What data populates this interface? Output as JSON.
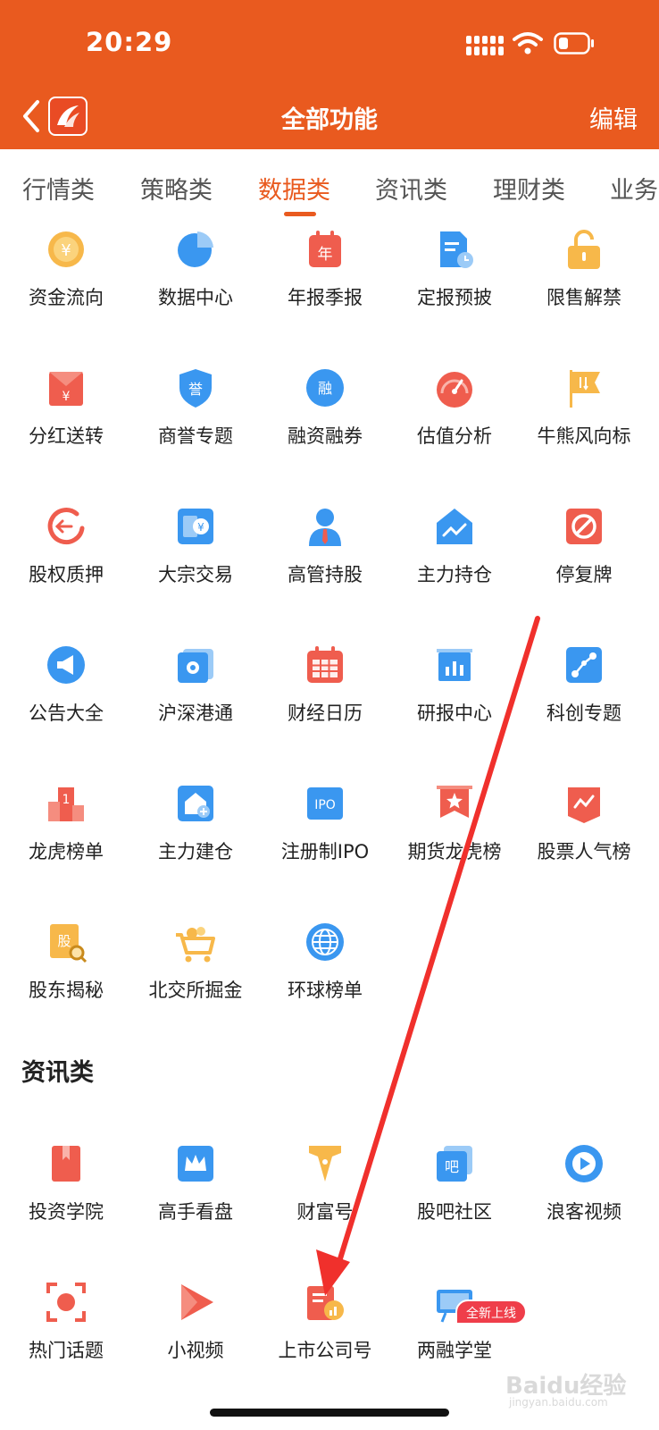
{
  "status": {
    "time": "20:29"
  },
  "header": {
    "title": "全部功能",
    "edit": "编辑"
  },
  "tabs": [
    {
      "label": "行情类"
    },
    {
      "label": "策略类"
    },
    {
      "label": "数据类",
      "active": true
    },
    {
      "label": "资讯类"
    },
    {
      "label": "理财类"
    },
    {
      "label": "业务"
    }
  ],
  "data_items": [
    {
      "label": "资金流向",
      "icon": "coin-flow-icon"
    },
    {
      "label": "数据中心",
      "icon": "pie-chart-icon"
    },
    {
      "label": "年报季报",
      "icon": "calendar-year-icon",
      "icon_text": "年"
    },
    {
      "label": "定报预披",
      "icon": "document-clock-icon"
    },
    {
      "label": "限售解禁",
      "icon": "unlock-icon"
    },
    {
      "label": "分红送转",
      "icon": "red-envelope-icon"
    },
    {
      "label": "商誉专题",
      "icon": "shield-icon",
      "icon_text": "誉"
    },
    {
      "label": "融资融券",
      "icon": "circle-badge-icon",
      "icon_text": "融"
    },
    {
      "label": "估值分析",
      "icon": "gauge-icon"
    },
    {
      "label": "牛熊风向标",
      "icon": "flag-icon"
    },
    {
      "label": "股权质押",
      "icon": "pledge-cycle-icon"
    },
    {
      "label": "大宗交易",
      "icon": "block-trade-icon"
    },
    {
      "label": "高管持股",
      "icon": "executive-icon"
    },
    {
      "label": "主力持仓",
      "icon": "house-chart-icon"
    },
    {
      "label": "停复牌",
      "icon": "stop-icon"
    },
    {
      "label": "公告大全",
      "icon": "megaphone-icon"
    },
    {
      "label": "沪深港通",
      "icon": "hk-flag-icon"
    },
    {
      "label": "财经日历",
      "icon": "calendar-icon"
    },
    {
      "label": "研报中心",
      "icon": "report-chart-icon"
    },
    {
      "label": "科创专题",
      "icon": "network-icon"
    },
    {
      "label": "龙虎榜单",
      "icon": "podium-icon",
      "icon_text": "1"
    },
    {
      "label": "主力建仓",
      "icon": "house-plus-icon"
    },
    {
      "label": "注册制IPO",
      "icon": "ipo-icon",
      "icon_text": "IPO"
    },
    {
      "label": "期货龙虎榜",
      "icon": "star-banner-icon"
    },
    {
      "label": "股票人气榜",
      "icon": "trend-banner-icon"
    },
    {
      "label": "股东揭秘",
      "icon": "shareholder-icon",
      "icon_text": "股"
    },
    {
      "label": "北交所掘金",
      "icon": "cart-icon"
    },
    {
      "label": "环球榜单",
      "icon": "globe-icon"
    }
  ],
  "news_section": {
    "title": "资讯类"
  },
  "news_items": [
    {
      "label": "投资学院",
      "icon": "book-icon"
    },
    {
      "label": "高手看盘",
      "icon": "crown-icon"
    },
    {
      "label": "财富号",
      "icon": "pen-icon"
    },
    {
      "label": "股吧社区",
      "icon": "forum-icon",
      "icon_text": "吧"
    },
    {
      "label": "浪客视频",
      "icon": "play-circle-icon"
    },
    {
      "label": "热门话题",
      "icon": "focus-icon"
    },
    {
      "label": "小视频",
      "icon": "play-triangle-icon"
    },
    {
      "label": "上市公司号",
      "icon": "company-icon"
    },
    {
      "label": "两融学堂",
      "icon": "classroom-icon",
      "badge": "全新上线"
    }
  ],
  "watermark": {
    "line1": "Baidu经验",
    "line2": "jingyan.baidu.com"
  },
  "colors": {
    "brand": "#e95a1f",
    "blue": "#3a97f0",
    "red": "#ef5d4e",
    "orange": "#f4a940",
    "annotation": "#f0302c"
  }
}
